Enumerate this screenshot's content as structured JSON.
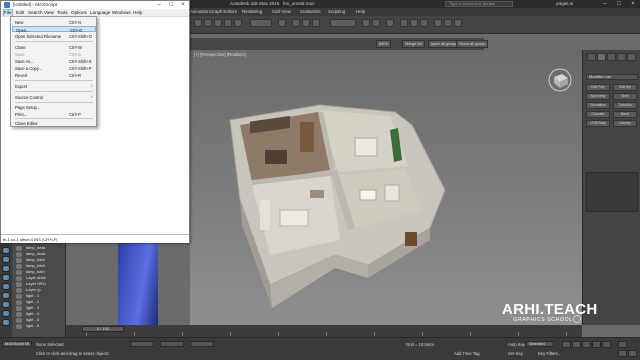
{
  "max_window": {
    "title": "Autodesk 3ds Max 2016",
    "filename": "fov_unreal.max",
    "search_placeholder": "Type a keyword or phrase",
    "user": "yoigan.ru",
    "menus": [
      "",
      "Edit",
      "Tools",
      "Group",
      "Views",
      "Create",
      "Modifiers",
      "Animation",
      "Graph Editors",
      "Rendering",
      "Civil View",
      "Customize",
      "Scripting",
      "Help"
    ]
  },
  "toolbar2": {
    "buttons": [
      "6800",
      "Merge All",
      "open all group",
      "Show all group"
    ]
  },
  "viewport": {
    "label": "[+] [Perspective] [Realistic]"
  },
  "command_panel": {
    "modifier_list": "Modifier List",
    "buttons": [
      "Edit Poly",
      "Edit Spl",
      "Symmetry",
      "Shell",
      "Normalize",
      "TurboSm",
      "Chamfer",
      "Bend",
      "UVW Map",
      "Unwrap"
    ]
  },
  "scene_explorer": {
    "rows": [
      "lamp_desk",
      "lamp_desk",
      "lamp_kitch",
      "lamp_kitch",
      "lamp_bath",
      "Layer ahidi",
      "Layer HRLi",
      "Layer rp",
      "light - 1",
      "light - 2",
      "light - 3",
      "light - 4",
      "light - 5",
      "light - 6"
    ]
  },
  "timeline": {
    "slider": "0 / 100",
    "ticks": [
      "0",
      "10",
      "20",
      "30",
      "40",
      "50",
      "60",
      "70",
      "80",
      "90",
      "100"
    ]
  },
  "status": {
    "listener": "MAXScript Mi",
    "selection": "None Selected",
    "prompt": "Click or click-and-drag to select objects",
    "grid": "Grid = 10,0mm",
    "add_time_tag": "Add Time Tag",
    "auto_key": "Auto Key",
    "set_key": "Set Key",
    "selected": "Selected",
    "key_filters": "Key Filters..."
  },
  "watermark": {
    "main": "ARHI.TEACH",
    "sub": "GRAPHICS SCHOOL"
  },
  "maxscript_window": {
    "title": "[Untitled] - MAXScript",
    "menus": [
      "File",
      "Edit",
      "Search",
      "View",
      "Tools",
      "Options",
      "Language",
      "Windows",
      "Help"
    ],
    "listener_text": "fn-1 co-1 offset-0 INS (CR+LF)"
  },
  "file_menu": {
    "items": [
      {
        "label": "New",
        "shortcut": "Ctrl+N",
        "enabled": true,
        "highlighted": false
      },
      {
        "label": "Open...",
        "shortcut": "Ctrl+O",
        "enabled": true,
        "highlighted": true
      },
      {
        "label": "Open Selected Filename",
        "shortcut": "Ctrl+Shift+O",
        "enabled": true,
        "highlighted": false
      },
      {
        "label": "Close",
        "shortcut": "Ctrl+W",
        "enabled": true,
        "highlighted": false
      },
      {
        "label": "Save",
        "shortcut": "Ctrl+S",
        "enabled": false,
        "highlighted": false
      },
      {
        "label": "Save As...",
        "shortcut": "Ctrl+Shift+S",
        "enabled": true,
        "highlighted": false
      },
      {
        "label": "Save a Copy...",
        "shortcut": "Ctrl+Shift+P",
        "enabled": true,
        "highlighted": false
      },
      {
        "label": "Revert",
        "shortcut": "Ctrl+R",
        "enabled": true,
        "highlighted": false
      },
      {
        "label": "Export",
        "shortcut": "",
        "enabled": true,
        "highlighted": false
      },
      {
        "label": "Source Control",
        "shortcut": "",
        "enabled": true,
        "highlighted": false
      },
      {
        "label": "Page Setup...",
        "shortcut": "",
        "enabled": true,
        "highlighted": false
      },
      {
        "label": "Print...",
        "shortcut": "Ctrl+P",
        "enabled": true,
        "highlighted": false
      },
      {
        "label": "Close Editor",
        "shortcut": "",
        "enabled": true,
        "highlighted": false
      }
    ]
  },
  "colors": {
    "highlight": "#cce4f7",
    "viewport_bg": "#7a7a7a",
    "panel_bg": "#444444"
  }
}
